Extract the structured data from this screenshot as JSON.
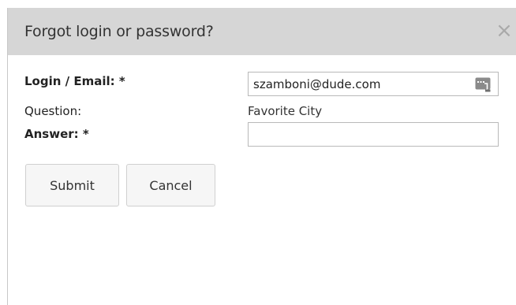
{
  "dialog": {
    "title": "Forgot login or password?",
    "close_icon": "close-icon",
    "close_glyph": "×"
  },
  "form": {
    "login_label": "Login / Email: *",
    "login_value": "szamboni@dude.com",
    "autofill_icon": "password-manager-icon",
    "question_label": "Question:",
    "question_value": "Favorite City",
    "answer_label": "Answer: *",
    "answer_value": ""
  },
  "buttons": {
    "submit_label": "Submit",
    "cancel_label": "Cancel"
  },
  "colors": {
    "titlebar_bg": "#d6d6d6",
    "button_bg": "#f6f6f6",
    "border": "#b9b9b9"
  }
}
